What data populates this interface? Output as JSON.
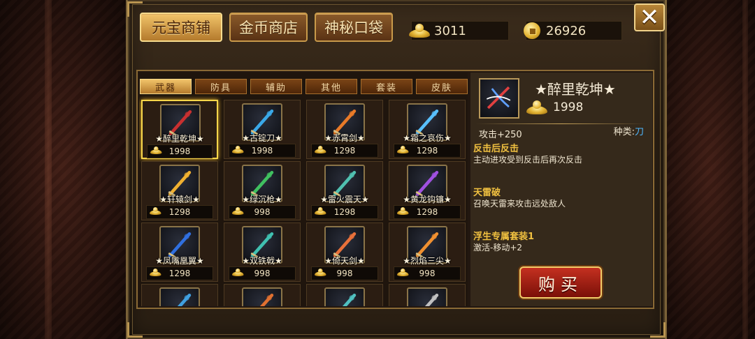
{
  "top_tabs": [
    {
      "label": "元宝商铺",
      "active": true
    },
    {
      "label": "金币商店",
      "active": false
    },
    {
      "label": "神秘口袋",
      "active": false
    }
  ],
  "currency": {
    "ingot": {
      "icon": "gold-ingot-icon",
      "value": "3011"
    },
    "coin": {
      "icon": "gold-coin-icon",
      "value": "26926"
    }
  },
  "close_label": "✕",
  "category_tabs": [
    {
      "label": "武器",
      "active": true
    },
    {
      "label": "防具",
      "active": false
    },
    {
      "label": "辅助",
      "active": false
    },
    {
      "label": "其他",
      "active": false
    },
    {
      "label": "套装",
      "active": false
    },
    {
      "label": "皮肤",
      "active": false
    }
  ],
  "items": [
    {
      "name": "★醉里乾坤★",
      "price": "1998",
      "color": "#c83030",
      "selected": true
    },
    {
      "name": "★古锭刀★",
      "price": "1998",
      "color": "#3aa8e8",
      "selected": false
    },
    {
      "name": "★赤霄剑★",
      "price": "1298",
      "color": "#e87a28",
      "selected": false
    },
    {
      "name": "★霜之哀伤★",
      "price": "1298",
      "color": "#58c0ff",
      "selected": false
    },
    {
      "name": "★轩辕剑★",
      "price": "1298",
      "color": "#f0b030",
      "selected": false
    },
    {
      "name": "★绿沉枪★",
      "price": "998",
      "color": "#40c060",
      "selected": false
    },
    {
      "name": "★雷火震天★",
      "price": "1298",
      "color": "#50c0b0",
      "selected": false
    },
    {
      "name": "★黄龙钩镰★",
      "price": "1298",
      "color": "#a050e0",
      "selected": false
    },
    {
      "name": "★凤嘴凰翼★",
      "price": "1298",
      "color": "#3070e0",
      "selected": false
    },
    {
      "name": "★双铁戟★",
      "price": "998",
      "color": "#40c0b0",
      "selected": false
    },
    {
      "name": "★倚天剑★",
      "price": "998",
      "color": "#e8703a",
      "selected": false
    },
    {
      "name": "★烈焰三尖★",
      "price": "998",
      "color": "#f09030",
      "selected": false
    },
    {
      "name": "",
      "price": "",
      "color": "#40a0e0",
      "selected": false
    },
    {
      "name": "",
      "price": "",
      "color": "#e07030",
      "selected": false
    },
    {
      "name": "",
      "price": "",
      "color": "#50c0c0",
      "selected": false
    },
    {
      "name": "",
      "price": "",
      "color": "#c0c0c0",
      "selected": false
    }
  ],
  "detail": {
    "name": "★醉里乾坤★",
    "price": "1998",
    "stat": "攻击+250",
    "kind_label": "种类:",
    "kind_value": "刀",
    "skills": [
      {
        "title": "反击后反击",
        "desc": "主动进攻受到反击后再次反击"
      },
      {
        "title": "天雷破",
        "desc": "召唤天雷来攻击远处敌人"
      },
      {
        "title": "浮生专属套装1",
        "desc": "激活-移动+2"
      }
    ],
    "buy_label": "购买"
  }
}
